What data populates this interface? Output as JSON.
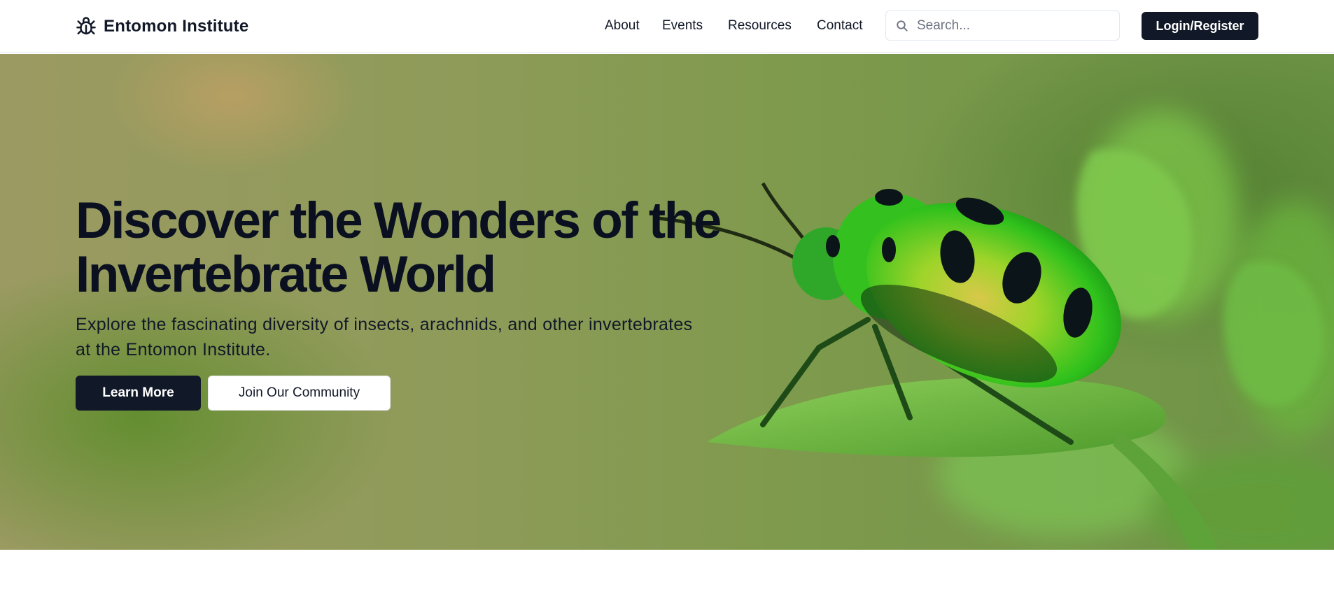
{
  "brand": {
    "name": "Entomon Institute",
    "icon": "bug-icon"
  },
  "nav": [
    {
      "label": "About"
    },
    {
      "label": "Events"
    },
    {
      "label": "Resources"
    },
    {
      "label": "Contact"
    }
  ],
  "search": {
    "placeholder": "Search...",
    "value": "",
    "icon": "search-icon"
  },
  "auth": {
    "login_label": "Login/Register"
  },
  "hero": {
    "title_line1": "Discover the Wonders of the",
    "title_line2": "Invertebrate World",
    "subtitle_line1": "Explore the fascinating diversity of insects, arachnids, and other invertebrates",
    "subtitle_line2": "at the Entomon Institute.",
    "primary_cta": "Learn More",
    "secondary_cta": "Join Our Community",
    "image_subject": "green-jewel-beetle-on-leaf"
  },
  "colors": {
    "primary": "#111827",
    "text": "#0f172a",
    "beetle_green": "#3fc41a",
    "leaf_green": "#6fb23a"
  }
}
